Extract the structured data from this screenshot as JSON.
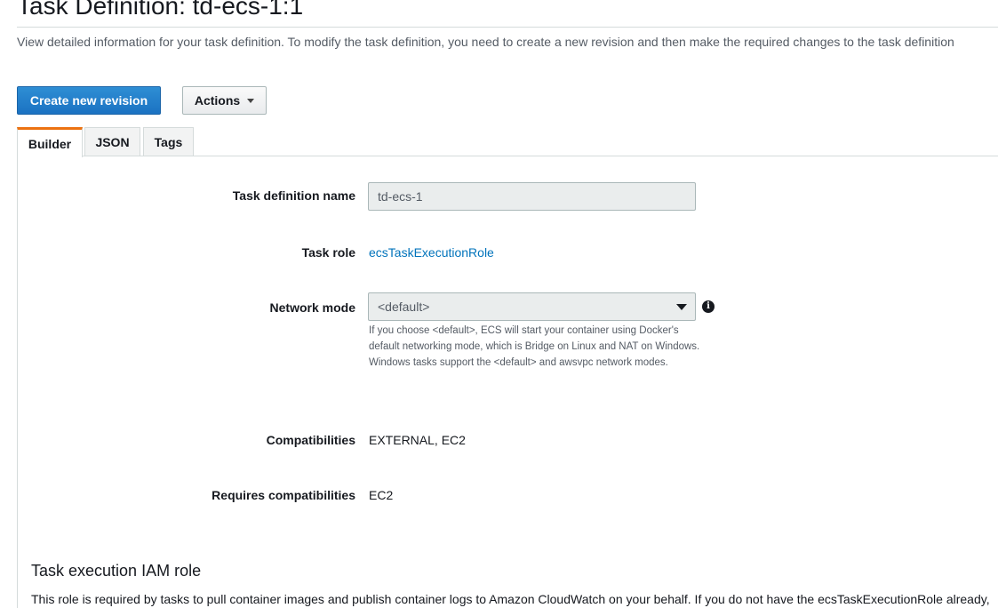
{
  "header": {
    "title": "Task Definition: td-ecs-1:1",
    "description": "View detailed information for your task definition. To modify the task definition, you need to create a new revision and then make the required changes to the task definition"
  },
  "toolbar": {
    "create_revision_label": "Create new revision",
    "actions_label": "Actions"
  },
  "tabs": [
    {
      "label": "Builder",
      "active": true
    },
    {
      "label": "JSON",
      "active": false
    },
    {
      "label": "Tags",
      "active": false
    }
  ],
  "form": {
    "task_definition_name": {
      "label": "Task definition name",
      "value": "td-ecs-1"
    },
    "task_role": {
      "label": "Task role",
      "value": "ecsTaskExecutionRole"
    },
    "network_mode": {
      "label": "Network mode",
      "value": "<default>",
      "help": "If you choose <default>, ECS will start your container using Docker's default networking mode, which is Bridge on Linux and NAT on Windows. Windows tasks support the <default> and awsvpc network modes.",
      "info_icon": "info-icon"
    },
    "compatibilities": {
      "label": "Compatibilities",
      "value": "EXTERNAL, EC2"
    },
    "requires_compatibilities": {
      "label": "Requires compatibilities",
      "value": "EC2"
    }
  },
  "execution_role_section": {
    "title": "Task execution IAM role",
    "description": "This role is required by tasks to pull container images and publish container logs to Amazon CloudWatch on your behalf. If you do not have the ecsTaskExecutionRole already,"
  },
  "colors": {
    "primary_button": "#1b72c2",
    "active_tab_accent": "#ec7211",
    "link": "#0073bb"
  }
}
